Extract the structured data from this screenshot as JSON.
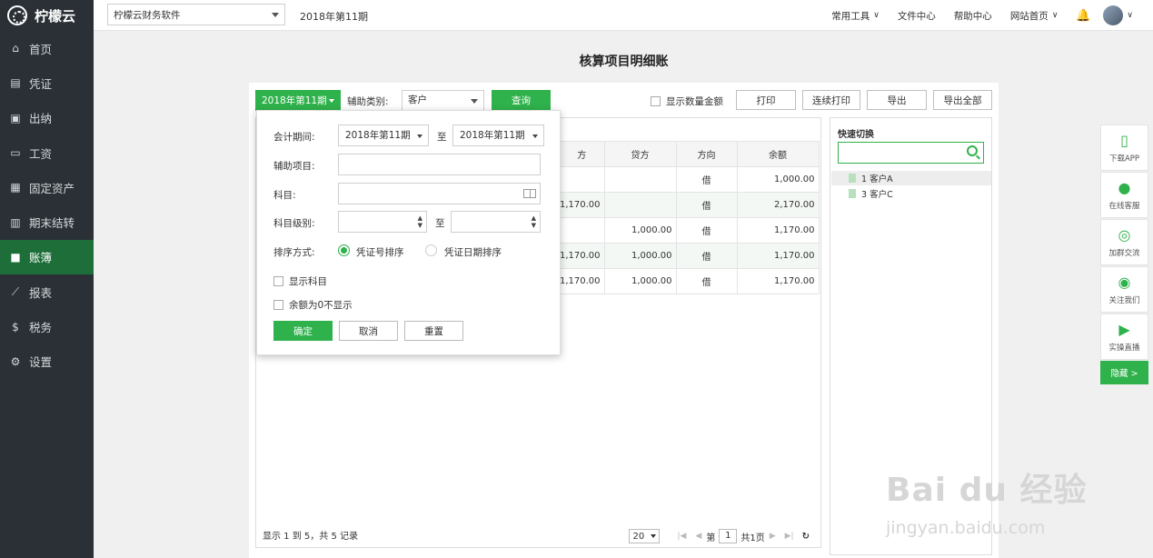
{
  "app": {
    "logo_text": "柠檬云"
  },
  "sidebar": {
    "items": [
      {
        "label": "首页",
        "icon": "home-icon"
      },
      {
        "label": "凭证",
        "icon": "voucher-icon"
      },
      {
        "label": "出纳",
        "icon": "cashier-icon"
      },
      {
        "label": "工资",
        "icon": "salary-icon"
      },
      {
        "label": "固定资产",
        "icon": "asset-icon"
      },
      {
        "label": "期末结转",
        "icon": "period-close-icon"
      },
      {
        "label": "账簿",
        "icon": "ledger-icon",
        "active": true
      },
      {
        "label": "报表",
        "icon": "report-icon"
      },
      {
        "label": "税务",
        "icon": "tax-icon"
      },
      {
        "label": "设置",
        "icon": "settings-icon"
      }
    ]
  },
  "topbar": {
    "company": "柠檬云财务软件",
    "period": "2018年第11期",
    "links": {
      "tools": "常用工具",
      "files": "文件中心",
      "help": "帮助中心",
      "site": "网站首页"
    }
  },
  "page": {
    "title": "核算项目明细账"
  },
  "toolbar": {
    "period_btn": "2018年第11期",
    "aux_label": "辅助类别:",
    "aux_value": "客户",
    "query": "查询",
    "show_qty": "显示数量金额",
    "print": "打印",
    "continuous_print": "连续打印",
    "export": "导出",
    "export_all": "导出全部"
  },
  "table": {
    "headers": [
      "方",
      "贷方",
      "方向",
      "余额"
    ],
    "rows": [
      [
        "",
        "",
        "借",
        "1,000.00"
      ],
      [
        "1,170.00",
        "",
        "借",
        "2,170.00"
      ],
      [
        "",
        "1,000.00",
        "借",
        "1,170.00"
      ],
      [
        "1,170.00",
        "1,000.00",
        "借",
        "1,170.00"
      ],
      [
        "1,170.00",
        "1,000.00",
        "借",
        "1,170.00"
      ]
    ],
    "footer": "显示 1 到 5，共 5 记录",
    "page_size": "20",
    "page_prefix": "第",
    "page_num": "1",
    "page_total": "共1页"
  },
  "quick": {
    "title": "快速切换",
    "items": [
      "1 客户A",
      "3 客户C"
    ]
  },
  "filter": {
    "period_label": "会计期间:",
    "period_from": "2018年第11期",
    "to": "至",
    "period_to": "2018年第11期",
    "aux_item_label": "辅助项目:",
    "subject_label": "科目:",
    "level_label": "科目级别:",
    "sort_label": "排序方式:",
    "sort_voucher": "凭证号排序",
    "sort_date": "凭证日期排序",
    "show_subject": "显示科目",
    "hide_zero": "余额为0不显示",
    "ok": "确定",
    "cancel": "取消",
    "reset": "重置"
  },
  "float": {
    "items": [
      "下载APP",
      "在线客服",
      "加群交流",
      "关注我们",
      "实操直播"
    ],
    "hide": "隐藏 >"
  },
  "watermark": {
    "text": "Bai du 经验",
    "url": "jingyan.baidu.com"
  },
  "colors": {
    "accent": "#2fb24b",
    "sidebar_bg": "#2a3036",
    "sidebar_active": "#1e6e3a"
  }
}
